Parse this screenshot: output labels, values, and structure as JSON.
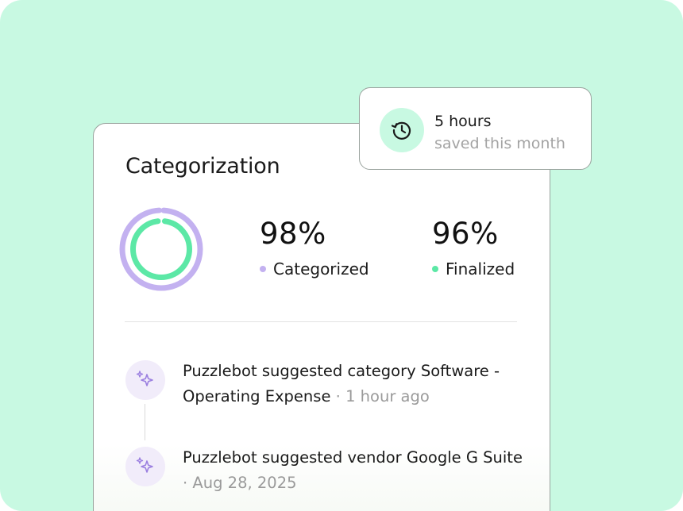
{
  "card": {
    "title": "Categorization",
    "stats": [
      {
        "value": "98%",
        "label": "Categorized",
        "color": "#c3b1f0"
      },
      {
        "value": "96%",
        "label": "Finalized",
        "color": "#5ce8a6"
      }
    ],
    "donut": {
      "outer_percent": 98,
      "inner_percent": 96,
      "outer_color": "#c3b1f0",
      "inner_color": "#5ce8a6"
    }
  },
  "activity": [
    {
      "icon": "sparkles-icon",
      "text": "Puzzlebot suggested category Software - Operating Expense",
      "meta": "1 hour ago"
    },
    {
      "icon": "sparkles-icon",
      "text": "Puzzlebot suggested vendor Google G Suite",
      "meta": "Aug 28, 2025"
    }
  ],
  "tooltip": {
    "icon": "history-icon",
    "title": "5 hours",
    "subtitle": "saved this month"
  },
  "colors": {
    "background": "#c8f9e2",
    "accent_purple": "#c3b1f0",
    "accent_green": "#5ce8a6"
  }
}
